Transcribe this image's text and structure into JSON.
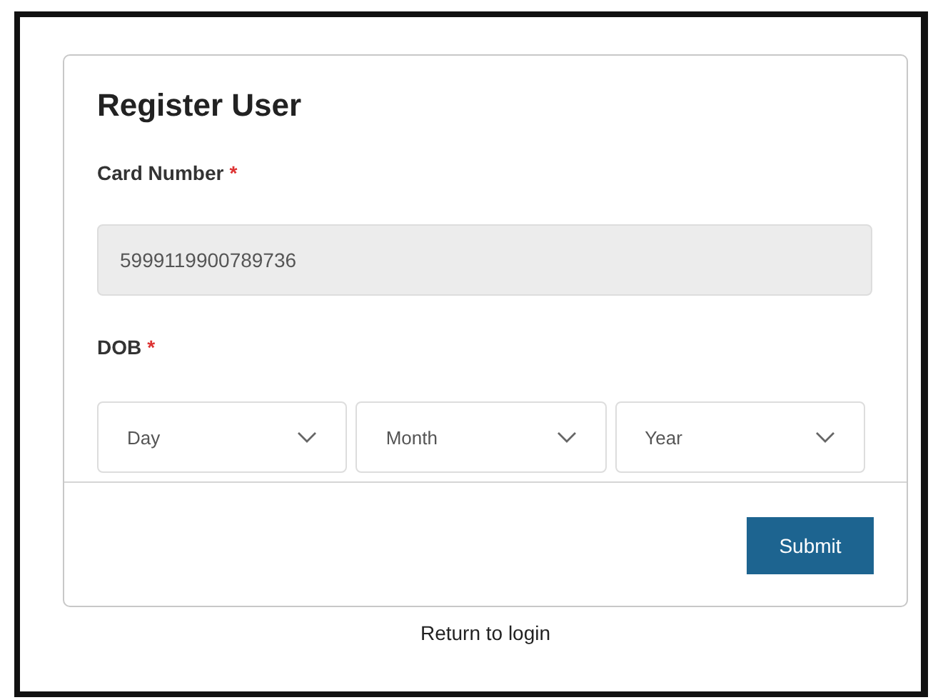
{
  "title": "Register User",
  "card_number": {
    "label": "Card Number",
    "required_mark": "*",
    "value": "5999119900789736",
    "disabled": true
  },
  "dob": {
    "label": "DOB",
    "required_mark": "*",
    "selects": [
      {
        "placeholder": "Day"
      },
      {
        "placeholder": "Month"
      },
      {
        "placeholder": "Year"
      }
    ]
  },
  "submit_button": "Submit",
  "return_link": "Return to login"
}
